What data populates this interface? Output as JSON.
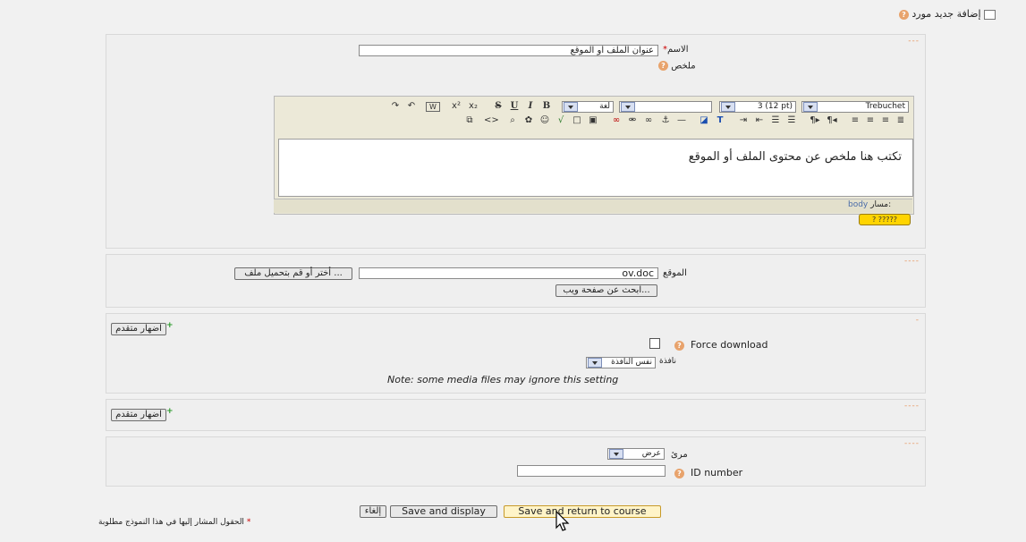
{
  "header": {
    "title": "إضافة جديد مورد"
  },
  "section_general": {
    "name_label": "الاسم",
    "required_mark": "*",
    "name_value": "عنوان الملف أو الموقع",
    "summary_label": "ملخص",
    "editor": {
      "font_family": "Trebuchet",
      "font_size": "3 (12 pt)",
      "language_label": "لغة",
      "content": "تكتب هنا ملخص عن محتوى الملف أو الموقع",
      "path_label": "مسار:",
      "path_value": "body",
      "help_badge": "? ?????"
    }
  },
  "section_location": {
    "location_label": "الموقع",
    "location_value": "ov.doc",
    "choose_upload_button": "أختر أو قم بتحميل ملف ...",
    "search_web_button": "ابحث عن صفحة ويب..."
  },
  "section_window": {
    "show_advanced_button": "اضهار متقدم",
    "force_download_label": "Force download",
    "window_label": "نافذة",
    "window_value": "نفس النافذة",
    "note": "Note: some media files may ignore this setting"
  },
  "section_advanced": {
    "show_advanced_button": "اضهار متقدم"
  },
  "section_common": {
    "visible_label": "مرئ",
    "visible_value": "عرض",
    "id_number_label": "ID number",
    "id_number_value": ""
  },
  "footer": {
    "cancel_button": "إلغاء",
    "save_display_button": "Save and display",
    "save_return_button": "Save and return to course",
    "required_note": "الحقول المشار إليها في هذا النموذج مطلوبة",
    "required_mark": "*"
  },
  "toolbar_icons": [
    "undo-icon",
    "redo-icon",
    "clean-html-icon",
    "superscript-icon",
    "subscript-icon",
    "strikethrough-icon",
    "underline-icon",
    "italic-icon",
    "bold-icon"
  ],
  "colors": {
    "background": "#f1f1f1",
    "accent_help": "#e8a36c",
    "required": "#cc0000",
    "highlight_button": "#fff4c8"
  }
}
